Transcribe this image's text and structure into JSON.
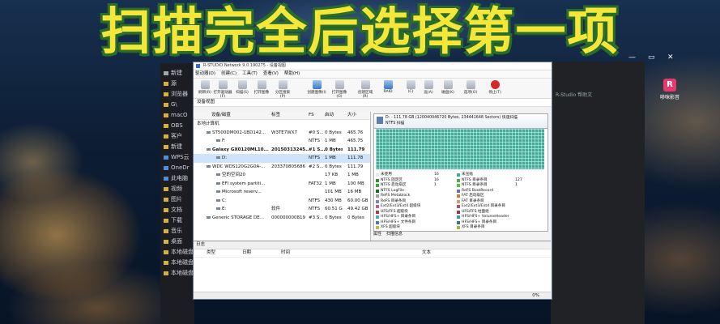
{
  "headline": "扫描完全后选择第一项",
  "sidebar": {
    "top_label": "新建",
    "items": [
      {
        "label": "源"
      },
      {
        "label": "浏览器"
      },
      {
        "label": "G\\"
      },
      {
        "label": "macO"
      },
      {
        "label": "OBS"
      },
      {
        "label": "客户"
      },
      {
        "label": "新建"
      },
      {
        "label": "WPS云"
      },
      {
        "label": "OneDr"
      },
      {
        "label": "此电脑"
      },
      {
        "label": "视频"
      },
      {
        "label": "图片"
      },
      {
        "label": "文档"
      },
      {
        "label": "下载"
      },
      {
        "label": "音乐"
      },
      {
        "label": "桌面"
      },
      {
        "label": "本地磁盘 (C:)"
      },
      {
        "label": "本地磁盘 (D:)"
      },
      {
        "label": "本地磁盘"
      }
    ]
  },
  "dark_window": {
    "label": "R-Studio 帮助文"
  },
  "desktop_icon": {
    "label": "哆咪影音",
    "glyph": "R"
  },
  "window_controls": {
    "min": "—",
    "max": "▭",
    "close": "✕"
  },
  "app": {
    "title": "R-STUDIO Network 9.0.190275 - 设备视图",
    "menus": [
      "驱动器(D)",
      "创建(C)",
      "工具(T)",
      "查看(V)",
      "帮助(H)"
    ],
    "toolbar": [
      {
        "label": "刷新(R)",
        "icon": "refresh-icon",
        "color": "g"
      },
      {
        "label": "打开驱动器(F)",
        "icon": "open-drive-icon",
        "color": "g"
      },
      {
        "label": "扫描(S)",
        "icon": "scan-icon",
        "color": "g"
      },
      {
        "label": "打开图像",
        "icon": "open-image-icon",
        "color": "g"
      },
      {
        "label": "分区搜索(P)",
        "icon": "partition-search-icon",
        "color": "g"
      },
      {
        "label": "创建图像(I)",
        "icon": "create-image-icon",
        "color": "b"
      },
      {
        "label": "打开图像(O)",
        "icon": "open-image2-icon",
        "color": "g"
      },
      {
        "label": "创建区域(R)",
        "icon": "create-region-icon",
        "color": "g"
      },
      {
        "label": "RAID",
        "icon": "raid-icon",
        "color": "b"
      },
      {
        "label": "(C)",
        "icon": "connect-icon",
        "color": "g"
      },
      {
        "label": "远(A)",
        "icon": "remote-icon",
        "color": "g"
      },
      {
        "label": "磁盘(K)",
        "icon": "disk-icon",
        "color": "g"
      },
      {
        "label": "选项(O)",
        "icon": "options-icon",
        "color": "g"
      },
      {
        "label": "停止(T)",
        "icon": "stop-icon",
        "color": "r"
      }
    ],
    "subbar": "设备视图",
    "device_columns": [
      "设备/磁盘",
      "标签",
      "FS",
      "启动",
      "大小"
    ],
    "devices": [
      {
        "name": "本地计算机",
        "label": "",
        "fs": "",
        "start": "",
        "size": "",
        "indent": 0,
        "bold": false,
        "selected": false
      },
      {
        "name": "ST500DM002-1BD142...",
        "label": "W3TE7WX7",
        "fs": "#0 S...",
        "start": "0 Bytes",
        "size": "465.76",
        "indent": 1,
        "bold": false,
        "selected": false
      },
      {
        "name": "F:",
        "label": "",
        "fs": "NTFS",
        "start": "1 MB",
        "size": "465.75",
        "indent": 2,
        "bold": false,
        "selected": false
      },
      {
        "name": "Galaxy GX0120ML10...",
        "label": "20150313245...",
        "fs": "#1 S...",
        "start": "0 Bytes",
        "size": "111.79",
        "indent": 1,
        "bold": true,
        "selected": false
      },
      {
        "name": "D:",
        "label": "",
        "fs": "NTFS",
        "start": "1 MB",
        "size": "111.78",
        "indent": 2,
        "bold": false,
        "selected": true
      },
      {
        "name": "WDC WDS120G2G0A-...",
        "label": "203370805686",
        "fs": "#2 S...",
        "start": "0 Bytes",
        "size": "111.79",
        "indent": 1,
        "bold": false,
        "selected": false
      },
      {
        "name": "空的空间20",
        "label": "",
        "fs": "",
        "start": "17 KB",
        "size": "1 MB",
        "indent": 2,
        "bold": false,
        "selected": false
      },
      {
        "name": "EFI system partiti...",
        "label": "",
        "fs": "FAT32",
        "start": "1 MB",
        "size": "100 MB",
        "indent": 2,
        "bold": false,
        "selected": false
      },
      {
        "name": "Microsoft reserv...",
        "label": "",
        "fs": "",
        "start": "101 MB",
        "size": "16 MB",
        "indent": 2,
        "bold": false,
        "selected": false
      },
      {
        "name": "C:",
        "label": "",
        "fs": "NTFS",
        "start": "430 MB",
        "size": "60.00 GB",
        "indent": 2,
        "bold": false,
        "selected": false
      },
      {
        "name": "E:",
        "label": "软件",
        "fs": "NTFS",
        "start": "60.51 GB",
        "size": "49.42 GB",
        "indent": 2,
        "bold": false,
        "selected": false
      },
      {
        "name": "Generic STORAGE DE...",
        "label": "000000000819",
        "fs": "#3 S...",
        "start": "0 Bytes",
        "size": "0 Bytes",
        "indent": 1,
        "bold": false,
        "selected": false
      }
    ],
    "disk_header_line1": "D: - 111.78 GB (120040046720 Bytes, 234441648 Sectors) 快速扫描",
    "disk_header_line2": "NTFS 扫描",
    "legend": {
      "left": [
        {
          "name": "未使用",
          "count": "16",
          "color": "#e8e8e8"
        },
        {
          "name": "NTFS 固定区",
          "count": "16",
          "color": "#2b8f2b"
        },
        {
          "name": "NTFS 启动扇区",
          "count": "1",
          "color": "#3aa53a"
        },
        {
          "name": "NTFS LogFile",
          "count": "",
          "color": "#1e6b1e"
        },
        {
          "name": "ReFS Metablock",
          "count": "",
          "color": "#a0a0a0"
        },
        {
          "name": "ReFS 目录条目",
          "count": "",
          "color": "#8080c0"
        },
        {
          "name": "Ext2/Ext3/Ext4 超级块",
          "count": "",
          "color": "#c06080"
        },
        {
          "name": "UFS/FFS 超级块",
          "count": "",
          "color": "#a04040"
        },
        {
          "name": "HFS/HFS+ 目录条目",
          "count": "",
          "color": "#60a0c0"
        },
        {
          "name": "HFS/HFS+ 文件条目",
          "count": "",
          "color": "#4080a0"
        },
        {
          "name": "XFS 超级块",
          "count": "",
          "color": "#c0c040"
        }
      ],
      "right": [
        {
          "name": "未压缩",
          "count": "",
          "color": "#3fae9a"
        },
        {
          "name": "NTFS 目录条目",
          "count": "127",
          "color": "#4ab04a"
        },
        {
          "name": "NTFS 目录条目",
          "count": "1",
          "color": "#50c050"
        },
        {
          "name": "ReFS BootRecord",
          "count": "",
          "color": "#7070b0"
        },
        {
          "name": "FAT 启动扇区",
          "count": "",
          "color": "#c08040"
        },
        {
          "name": "FAT 目录条目",
          "count": "",
          "color": "#d0a060"
        },
        {
          "name": "Ext2/Ext3/Ext4 目录条目",
          "count": "",
          "color": "#b05070"
        },
        {
          "name": "UFS/FFS 柱面组",
          "count": "",
          "color": "#904040"
        },
        {
          "name": "HFS/HFS+ VolumeHeader",
          "count": "",
          "color": "#5090b0"
        },
        {
          "name": "HFS/HFS+ 目录条目",
          "count": "",
          "color": "#407090"
        },
        {
          "name": "XFS 目录条目",
          "count": "",
          "color": "#b0b040"
        }
      ]
    },
    "tabs": [
      "属性",
      "扫描信息"
    ],
    "log": {
      "title": "日志",
      "columns": [
        "类型",
        "日期",
        "时间",
        "文本"
      ]
    },
    "status_percent": "0%"
  }
}
